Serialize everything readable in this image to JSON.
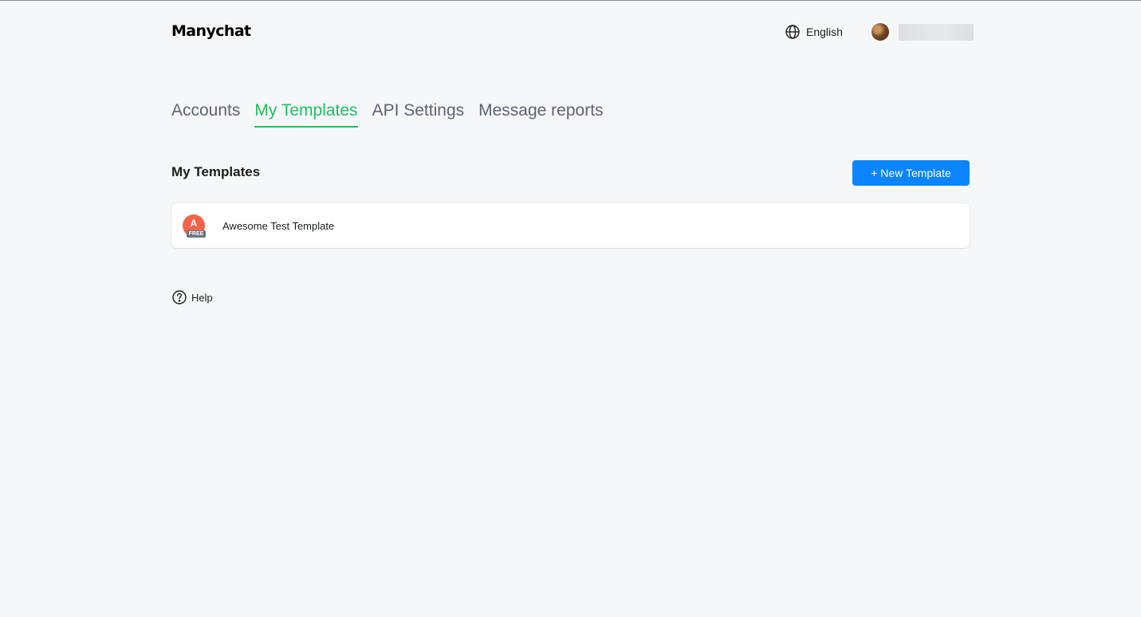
{
  "header": {
    "logo": "Manychat",
    "language": "English",
    "language_icon": "globe-icon"
  },
  "tabs": [
    {
      "label": "Accounts",
      "active": false
    },
    {
      "label": "My Templates",
      "active": true
    },
    {
      "label": "API Settings",
      "active": false
    },
    {
      "label": "Message reports",
      "active": false
    }
  ],
  "main": {
    "title": "My Templates",
    "new_button_label": "+ New Template",
    "templates": [
      {
        "initial": "A",
        "badge": "FREE",
        "name": "Awesome Test Template"
      }
    ]
  },
  "help": {
    "label": "Help",
    "icon": "question-circle-icon"
  },
  "colors": {
    "accent_green": "#1fbf61",
    "primary_blue": "#0a84ff",
    "avatar_red": "#f2634a",
    "background": "#f6f7f9"
  }
}
